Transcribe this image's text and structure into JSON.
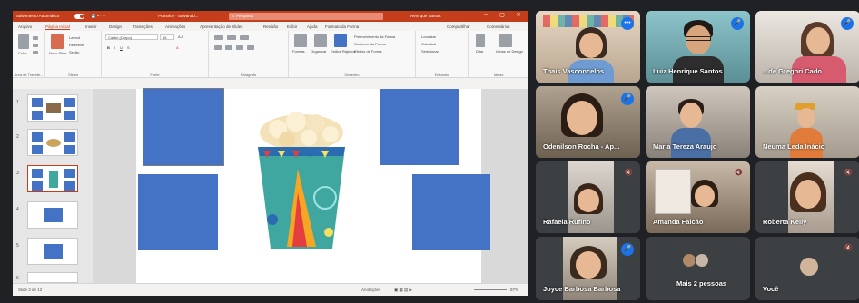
{
  "ppt": {
    "title_left": "Salvamento Automático",
    "title_center": "Prantrice · Salvando...",
    "search_placeholder": "Pesquisar",
    "user": "Henrique Santos",
    "tabs": [
      "Arquivo",
      "Página Inicial",
      "Inserir",
      "Design",
      "Transições",
      "Animações",
      "Apresentação de Slides",
      "Revisão",
      "Exibir",
      "Ajuda",
      "Formato da Forma"
    ],
    "share_label": "Compartilhar",
    "comments_label": "Comentários",
    "groups": [
      "Área de Transfe...",
      "Slides",
      "Fonte",
      "Parágrafo",
      "Desenho",
      "Editando",
      "Ideias"
    ],
    "ribbon_labels": {
      "paste": "Colar",
      "new_slide": "Novo Slide",
      "layout": "Layout",
      "reset": "Redefinir",
      "section": "Seção",
      "font": "Calibri (Corpo)",
      "size": "18",
      "shapes": "Formas",
      "arrange": "Organizar",
      "quick_styles": "Estilos Rápidos",
      "fill": "Preenchimento da Forma",
      "outline": "Contorno da Forma",
      "effects": "Efeitos de Forma",
      "find": "Localizar",
      "replace": "Substituir",
      "select": "Selecionar",
      "dictate": "Ditar",
      "design_ideas": "Ideias de Design"
    },
    "slide_numbers": [
      "1",
      "2",
      "3",
      "4",
      "5",
      "6"
    ],
    "status_slide": "Slide 3 de 12",
    "status_notes": "Anotações",
    "status_zoom": "87%"
  },
  "meet": {
    "tiles": [
      {
        "name": "Thais Vasconcelos",
        "state": "speaking"
      },
      {
        "name": "Luiz Henrique Santos",
        "state": "mic"
      },
      {
        "name": "...de Gregori Cado",
        "state": "mic"
      },
      {
        "name": "Odenilson Rocha - Ap...",
        "state": "mic"
      },
      {
        "name": "Maria Tereza Araujo",
        "state": "none"
      },
      {
        "name": "Neuma Leda Inácio",
        "state": "none"
      },
      {
        "name": "Rafaela Rufino",
        "state": "muted"
      },
      {
        "name": "Amanda Falcão",
        "state": "muted"
      },
      {
        "name": "Roberta Kelly",
        "state": "muted"
      },
      {
        "name": "Joyce Barbosa Barbosa",
        "state": "mic"
      },
      {
        "name": "Mais 2 pessoas",
        "state": "none"
      },
      {
        "name": "Você",
        "state": "muted"
      }
    ]
  },
  "colors": {
    "ppt_accent": "#c43e1c",
    "shape_blue": "#4472c4",
    "meet_bg": "#202124",
    "tile_bg": "#3c4043",
    "mic_blue": "#1a73e8"
  }
}
